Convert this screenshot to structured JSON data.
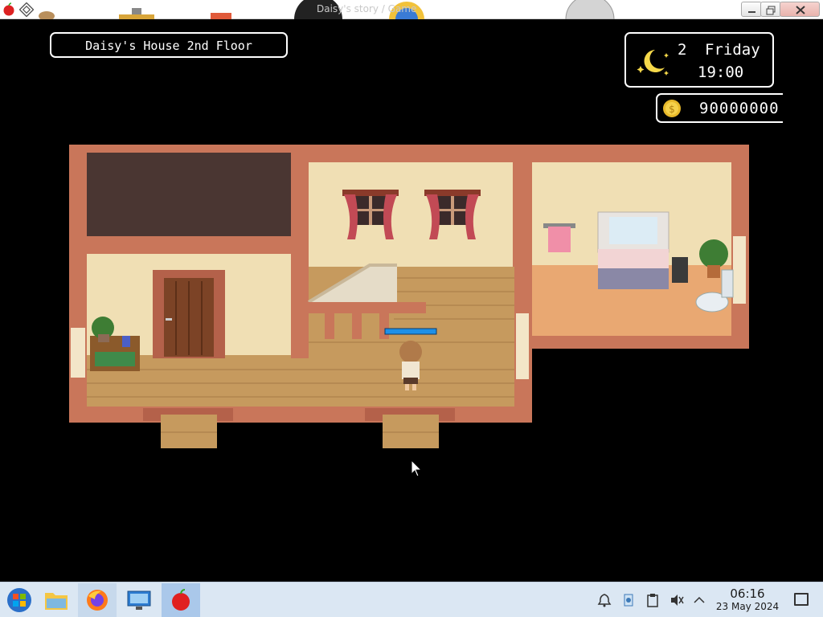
{
  "window": {
    "title": "Daisy's story / Game"
  },
  "hud": {
    "location": "Daisy's House 2nd Floor",
    "day_number": "2",
    "day_name": "Friday",
    "time": "19:00",
    "money": "90000000",
    "time_icon": "moon-icon",
    "money_icon": "coin-icon"
  },
  "taskbar": {
    "clock_time": "06:16",
    "clock_date": "23 May 2024",
    "apps": [
      "start-menu",
      "file-manager",
      "firefox",
      "system-monitor",
      "game"
    ],
    "tray": [
      "notification-bell-icon",
      "network-icon",
      "clipboard-icon",
      "volume-muted-icon",
      "tray-expand-icon"
    ]
  },
  "colors": {
    "wall_cream": "#f0dfb4",
    "wall_trim": "#c9765a",
    "floor_wood": "#c69a5e",
    "hud_border": "#ffffff",
    "taskbar_bg": "#dbe7f3"
  }
}
